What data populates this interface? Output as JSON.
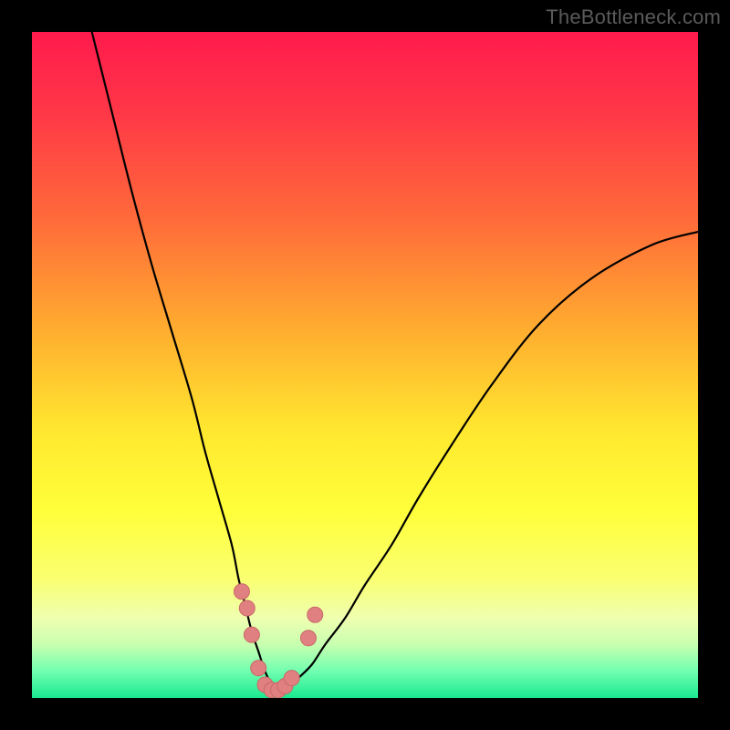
{
  "watermark": "TheBottleneck.com",
  "colors": {
    "black": "#000000",
    "curve": "#000000",
    "marker_fill": "#e08080",
    "marker_stroke": "#c86868",
    "gradient_stops": [
      {
        "offset": "0%",
        "color": "#ff1a4d"
      },
      {
        "offset": "12%",
        "color": "#ff3747"
      },
      {
        "offset": "28%",
        "color": "#ff6a3a"
      },
      {
        "offset": "45%",
        "color": "#ffae2f"
      },
      {
        "offset": "60%",
        "color": "#ffe82f"
      },
      {
        "offset": "72%",
        "color": "#ffff3a"
      },
      {
        "offset": "82%",
        "color": "#faff70"
      },
      {
        "offset": "88%",
        "color": "#efffb0"
      },
      {
        "offset": "92%",
        "color": "#c8ffb0"
      },
      {
        "offset": "96%",
        "color": "#70ffb0"
      },
      {
        "offset": "100%",
        "color": "#18e890"
      }
    ]
  },
  "chart_data": {
    "type": "line",
    "title": "",
    "xlabel": "",
    "ylabel": "",
    "xlim": [
      0,
      100
    ],
    "ylim": [
      0,
      100
    ],
    "grid": false,
    "legend": false,
    "note": "V-shaped bottleneck curve on rainbow heat gradient; values estimated from pixel positions (0..100 each axis, origin bottom-left).",
    "series": [
      {
        "name": "bottleneck-curve",
        "x": [
          9,
          12,
          15,
          18,
          21,
          24,
          26,
          28,
          30,
          31,
          32,
          33,
          34,
          35,
          36,
          37,
          38,
          39,
          40,
          42,
          44,
          47,
          50,
          54,
          58,
          63,
          69,
          76,
          84,
          93,
          100
        ],
        "y": [
          100,
          88,
          76,
          65,
          55,
          45,
          37,
          30,
          23,
          18,
          14,
          10,
          7,
          4,
          2,
          1,
          1,
          2,
          3,
          5,
          8,
          12,
          17,
          23,
          30,
          38,
          47,
          56,
          63,
          68,
          70
        ]
      }
    ],
    "markers": [
      {
        "x": 31.5,
        "y": 16
      },
      {
        "x": 32.3,
        "y": 13.5
      },
      {
        "x": 33.0,
        "y": 9.5
      },
      {
        "x": 34.0,
        "y": 4.5
      },
      {
        "x": 35.0,
        "y": 2.0
      },
      {
        "x": 36.0,
        "y": 1.2
      },
      {
        "x": 37.0,
        "y": 1.2
      },
      {
        "x": 38.0,
        "y": 1.8
      },
      {
        "x": 39.0,
        "y": 3.0
      },
      {
        "x": 41.5,
        "y": 9.0
      },
      {
        "x": 42.5,
        "y": 12.5
      }
    ]
  }
}
